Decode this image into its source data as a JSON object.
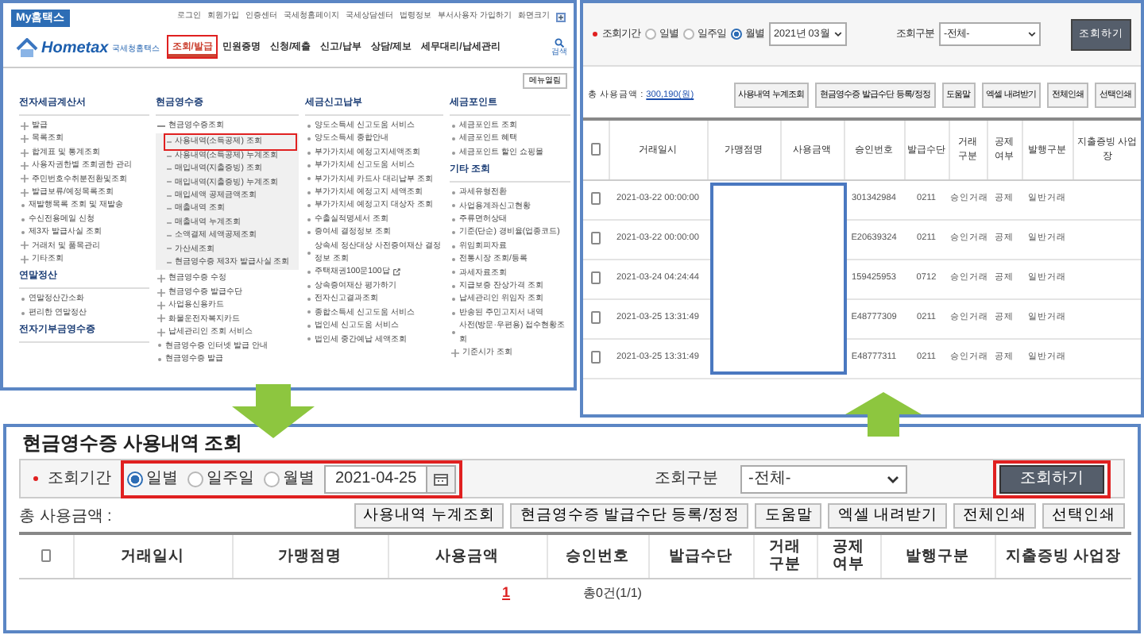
{
  "home_menu": {
    "badge": "My홈택스",
    "top_links": [
      "로그인",
      "회원가입",
      "인증센터",
      "국세청홈페이지",
      "국세상담센터",
      "법령정보",
      "부서사용자 가입하기",
      "화면크기"
    ],
    "logo": {
      "name": "Hometax",
      "subtitle": "국세청홈택스"
    },
    "nav": [
      {
        "label": "조회/발급",
        "selected": true
      },
      {
        "label": "민원증명",
        "selected": false
      },
      {
        "label": "신청/제출",
        "selected": false
      },
      {
        "label": "신고/납부",
        "selected": false
      },
      {
        "label": "상담/제보",
        "selected": false
      },
      {
        "label": "세무대리/납세관리",
        "selected": false
      }
    ],
    "search_label": "검색",
    "menu_button": "메뉴열림",
    "columns": [
      [
        {
          "title": "전자세금계산서",
          "items": [
            {
              "label": "발급",
              "kind": "plus",
              "highlighted": false
            },
            {
              "label": "목록조회",
              "kind": "plus",
              "highlighted": false
            },
            {
              "label": "합계표 및 통계조회",
              "kind": "plus",
              "highlighted": false
            },
            {
              "label": "사용자권한별 조회권한 관리",
              "kind": "plus",
              "highlighted": false
            },
            {
              "label": "주민번호수취분전환및조회",
              "kind": "plus",
              "highlighted": false
            },
            {
              "label": "발급보류/예정목록조회",
              "kind": "plus",
              "highlighted": false
            },
            {
              "label": "재발행목록 조회 및 재발송",
              "kind": "bullet",
              "highlighted": false
            },
            {
              "label": "수신전용메일 신청",
              "kind": "bullet",
              "highlighted": false
            },
            {
              "label": "제3자 발급사실 조회",
              "kind": "bullet",
              "highlighted": false
            },
            {
              "label": "거래처 및 품목관리",
              "kind": "plus",
              "highlighted": false
            },
            {
              "label": "기타조회",
              "kind": "plus",
              "highlighted": false
            }
          ]
        },
        {
          "title": "연말정산",
          "items": [
            {
              "label": "연말정산간소화",
              "kind": "bullet",
              "highlighted": false
            },
            {
              "label": "편리한 연말정산",
              "kind": "bullet",
              "highlighted": false
            }
          ]
        },
        {
          "title": "전자기부금영수증"
        }
      ],
      [
        {
          "title": "현금영수증",
          "items": [
            {
              "label": "현금영수증조회",
              "kind": "minus",
              "highlighted": false,
              "children": [
                {
                  "label": "사용내역(소득공제) 조회",
                  "highlighted": true
                },
                {
                  "label": "사용내역(소득공제) 누계조회",
                  "highlighted": false
                },
                {
                  "label": "매입내역(지출증빙) 조회",
                  "highlighted": false
                },
                {
                  "label": "매입내역(지출증빙) 누계조회",
                  "highlighted": false
                },
                {
                  "label": "매입세액 공제금액조회",
                  "highlighted": false
                },
                {
                  "label": "매출내역 조회",
                  "highlighted": false
                },
                {
                  "label": "매출내역 누계조회",
                  "highlighted": false
                },
                {
                  "label": "소액결제 세액공제조회",
                  "highlighted": false
                },
                {
                  "label": "가산세조회",
                  "highlighted": false
                },
                {
                  "label": "현금영수증 제3자 발급사실 조회",
                  "highlighted": false
                }
              ]
            },
            {
              "label": "현금영수증 수정",
              "kind": "plus",
              "highlighted": false
            },
            {
              "label": "현금영수증 발급수단",
              "kind": "plus",
              "highlighted": false
            },
            {
              "label": "사업용신용카드",
              "kind": "plus",
              "highlighted": false
            },
            {
              "label": "화물운전자복지카드",
              "kind": "plus",
              "highlighted": false
            },
            {
              "label": "납세관리인 조회 서비스",
              "kind": "plus",
              "highlighted": false
            },
            {
              "label": "현금영수증 인터넷 발급 안내",
              "kind": "bullet",
              "highlighted": false
            },
            {
              "label": "현금영수증 발급",
              "kind": "bullet",
              "highlighted": false
            }
          ]
        }
      ],
      [
        {
          "title": "세금신고납부",
          "items": [
            {
              "label": "양도소득세 신고도움 서비스",
              "kind": "bullet",
              "highlighted": false
            },
            {
              "label": "양도소득세 종합안내",
              "kind": "bullet",
              "highlighted": false
            },
            {
              "label": "부가가치세 예정고지세액조회",
              "kind": "bullet",
              "highlighted": false
            },
            {
              "label": "부가가치세 신고도움 서비스",
              "kind": "bullet",
              "highlighted": false
            },
            {
              "label": "부가가치세 카드사 대리납부 조회",
              "kind": "bullet",
              "highlighted": false
            },
            {
              "label": "부가가치세 예정고지 세액조회",
              "kind": "bullet",
              "highlighted": false
            },
            {
              "label": "부가가치세 예정고지 대상자 조회",
              "kind": "bullet",
              "highlighted": false
            },
            {
              "label": "수출실적명세서 조회",
              "kind": "bullet",
              "highlighted": false
            },
            {
              "label": "증여세 결정정보 조회",
              "kind": "bullet",
              "highlighted": false
            },
            {
              "label": "상속세 정산대상 사전증여재산 결정정보 조회",
              "kind": "bullet",
              "highlighted": false
            },
            {
              "label": "주택채권100문100답",
              "kind": "external",
              "highlighted": false
            },
            {
              "label": "상속증여재산 평가하기",
              "kind": "bullet",
              "highlighted": false
            },
            {
              "label": "전자신고결과조회",
              "kind": "bullet",
              "highlighted": false
            },
            {
              "label": "종합소득세 신고도움 서비스",
              "kind": "bullet",
              "highlighted": false
            },
            {
              "label": "법인세 신고도움 서비스",
              "kind": "bullet",
              "highlighted": false
            },
            {
              "label": "법인세 중간예납 세액조회",
              "kind": "bullet",
              "highlighted": false
            }
          ]
        }
      ],
      [
        {
          "title": "세금포인트",
          "items": [
            {
              "label": "세금포인트 조회",
              "kind": "bullet",
              "highlighted": false
            },
            {
              "label": "세금포인트 혜택",
              "kind": "bullet",
              "highlighted": false
            },
            {
              "label": "세금포인트 할인 쇼핑몰",
              "kind": "bullet",
              "highlighted": false
            }
          ]
        },
        {
          "title": "기타 조회",
          "items": [
            {
              "label": "과세유형전환",
              "kind": "bullet",
              "highlighted": false
            },
            {
              "label": "사업용계좌신고현황",
              "kind": "bullet",
              "highlighted": false
            },
            {
              "label": "주류면허상태",
              "kind": "bullet",
              "highlighted": false
            },
            {
              "label": "기준(단순) 경비율(업종코드)",
              "kind": "bullet",
              "highlighted": false
            },
            {
              "label": "위임회피자료",
              "kind": "bullet",
              "highlighted": false
            },
            {
              "label": "전통시장 조회/등록",
              "kind": "bullet",
              "highlighted": false
            },
            {
              "label": "과세자료조회",
              "kind": "bullet",
              "highlighted": false
            },
            {
              "label": "지급보증 잔상가격 조회",
              "kind": "bullet",
              "highlighted": false
            },
            {
              "label": "납세관리인 위임자 조회",
              "kind": "bullet",
              "highlighted": false
            },
            {
              "label": "반송된 주민고지서 내역",
              "kind": "bullet",
              "highlighted": false
            },
            {
              "label": "사전(방문·우편용) 접수현황조회",
              "kind": "bullet",
              "highlighted": false
            },
            {
              "label": "기준시가 조회",
              "kind": "plus",
              "highlighted": false
            }
          ]
        }
      ]
    ]
  },
  "month_panel": {
    "period_label": "조회기간",
    "period_options": [
      {
        "label": "일별",
        "selected": false
      },
      {
        "label": "일주일",
        "selected": false
      },
      {
        "label": "월별",
        "selected": true
      }
    ],
    "month": "2021년 03월",
    "type_label": "조회구분",
    "type_value": "-전체-",
    "search_button": "조회하기",
    "total_label": "총 사용금액 :",
    "total_value": "300,190(원)",
    "buttons": [
      "사용내역 누계조회",
      "현금영수증 발급수단 등록/정정",
      "도움말",
      "엑셀 내려받기",
      "전체인쇄",
      "선택인쇄"
    ],
    "columns": [
      "거래일시",
      "가맹점명",
      "사용금액",
      "승인번호",
      "발급수단",
      "거래구분",
      "공제여부",
      "발행구분",
      "지출증빙 사업장"
    ],
    "header_checked": false,
    "rows": [
      {
        "checked": false,
        "datetime": "2021-03-22 00:00:00",
        "approval": "301342984",
        "method": "0211",
        "deal_type": "승인거래",
        "deduction": "공제",
        "issue_type": "일반거래"
      },
      {
        "checked": false,
        "datetime": "2021-03-22 00:00:00",
        "approval": "E20639324",
        "method": "0211",
        "deal_type": "승인거래",
        "deduction": "공제",
        "issue_type": "일반거래"
      },
      {
        "checked": false,
        "datetime": "2021-03-24 04:24:44",
        "approval": "159425953",
        "method": "0712",
        "deal_type": "승인거래",
        "deduction": "공제",
        "issue_type": "일반거래"
      },
      {
        "checked": false,
        "datetime": "2021-03-25 13:31:49",
        "approval": "E48777309",
        "method": "0211",
        "deal_type": "승인거래",
        "deduction": "공제",
        "issue_type": "일반거래"
      },
      {
        "checked": false,
        "datetime": "2021-03-25 13:31:49",
        "approval": "E48777311",
        "method": "0211",
        "deal_type": "승인거래",
        "deduction": "공제",
        "issue_type": "일반거래"
      }
    ]
  },
  "main_panel": {
    "title": "현금영수증 사용내역 조회",
    "period_label": "조회기간",
    "period_options": [
      {
        "label": "일별",
        "selected": true
      },
      {
        "label": "일주일",
        "selected": false
      },
      {
        "label": "월별",
        "selected": false
      }
    ],
    "date": "2021-04-25",
    "period_highlighted": true,
    "type_label": "조회구분",
    "type_value": "-전체-",
    "search_button": "조회하기",
    "search_highlighted": true,
    "total_label": "총 사용금액 :",
    "buttons": [
      "사용내역 누계조회",
      "현금영수증 발급수단 등록/정정",
      "도움말",
      "엑셀 내려받기",
      "전체인쇄",
      "선택인쇄"
    ],
    "columns": [
      "거래일시",
      "가맹점명",
      "사용금액",
      "승인번호",
      "발급수단",
      "거래구분",
      "공제여부",
      "발행구분",
      "지출증빙 사업장"
    ],
    "header_checked": false,
    "pages": [
      {
        "label": "1",
        "selected": true
      }
    ],
    "summary": "총0건(1/1)"
  }
}
